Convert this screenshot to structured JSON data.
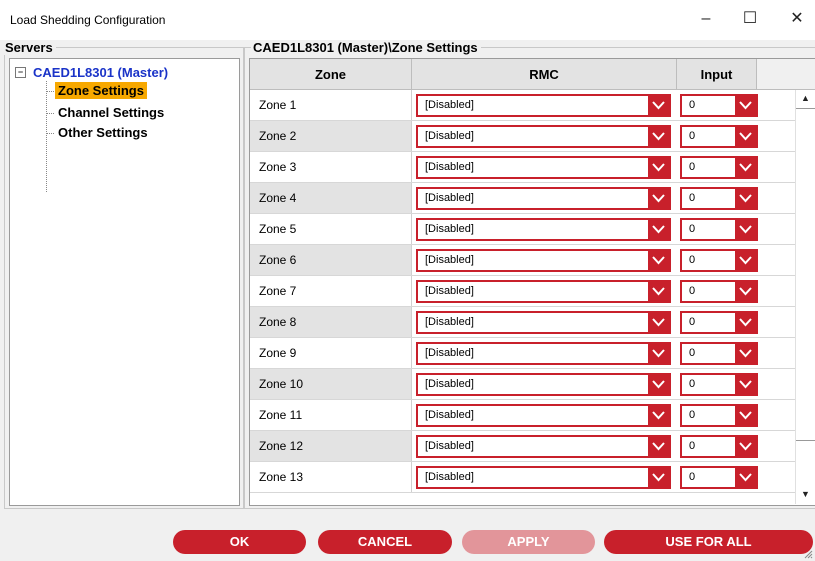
{
  "window": {
    "title": "Load Shedding Configuration",
    "minimize": "–",
    "maximize": "☐",
    "close": "✕"
  },
  "servers": {
    "label": "Servers",
    "root": "CAED1L8301 (Master)",
    "items": [
      "Zone Settings",
      "Channel Settings",
      "Other Settings"
    ],
    "selected": "Zone Settings"
  },
  "panel": {
    "label": "CAED1L8301 (Master)\\Zone Settings"
  },
  "table": {
    "headers": [
      "Zone",
      "RMC",
      "Input"
    ],
    "rows": [
      {
        "zone": "Zone 1",
        "rmc": "[Disabled]",
        "input": "0"
      },
      {
        "zone": "Zone 2",
        "rmc": "[Disabled]",
        "input": "0"
      },
      {
        "zone": "Zone 3",
        "rmc": "[Disabled]",
        "input": "0"
      },
      {
        "zone": "Zone 4",
        "rmc": "[Disabled]",
        "input": "0"
      },
      {
        "zone": "Zone 5",
        "rmc": "[Disabled]",
        "input": "0"
      },
      {
        "zone": "Zone 6",
        "rmc": "[Disabled]",
        "input": "0"
      },
      {
        "zone": "Zone 7",
        "rmc": "[Disabled]",
        "input": "0"
      },
      {
        "zone": "Zone 8",
        "rmc": "[Disabled]",
        "input": "0"
      },
      {
        "zone": "Zone 9",
        "rmc": "[Disabled]",
        "input": "0"
      },
      {
        "zone": "Zone 10",
        "rmc": "[Disabled]",
        "input": "0"
      },
      {
        "zone": "Zone 11",
        "rmc": "[Disabled]",
        "input": "0"
      },
      {
        "zone": "Zone 12",
        "rmc": "[Disabled]",
        "input": "0"
      },
      {
        "zone": "Zone 13",
        "rmc": "[Disabled]",
        "input": "0"
      }
    ]
  },
  "buttons": {
    "ok": "OK",
    "cancel": "CANCEL",
    "apply": "APPLY",
    "use_for_all": "USE FOR ALL"
  },
  "colors": {
    "accent": "#c8202b",
    "selection": "#f7a800",
    "tree_root": "#1a33c8",
    "disabled_button": "#e2959a"
  }
}
